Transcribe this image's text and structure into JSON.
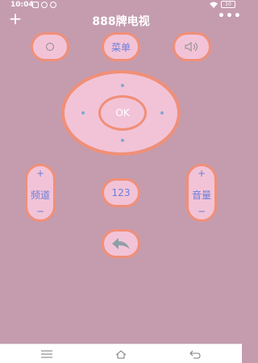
{
  "status_bar": {
    "time": "10:04",
    "battery": "10"
  },
  "header": {
    "title": "888牌电视",
    "add_symbol": "+",
    "more_symbol": "•••"
  },
  "buttons": {
    "menu_label": "菜单",
    "ok_label": "OK",
    "number_label": "123"
  },
  "rockers": {
    "channel": {
      "plus": "+",
      "label": "频道",
      "minus": "−"
    },
    "volume": {
      "plus": "+",
      "label": "音量",
      "minus": "−"
    }
  },
  "icons": {
    "power": "power-icon",
    "volume": "speaker-icon",
    "back": "back-arrow-icon"
  },
  "colors": {
    "background": "#c59cae",
    "button_fill": "#f2c3d7",
    "button_border": "#f08f78",
    "label_text": "#6b7ed8",
    "dpad_dots": "#7fa8d8"
  }
}
